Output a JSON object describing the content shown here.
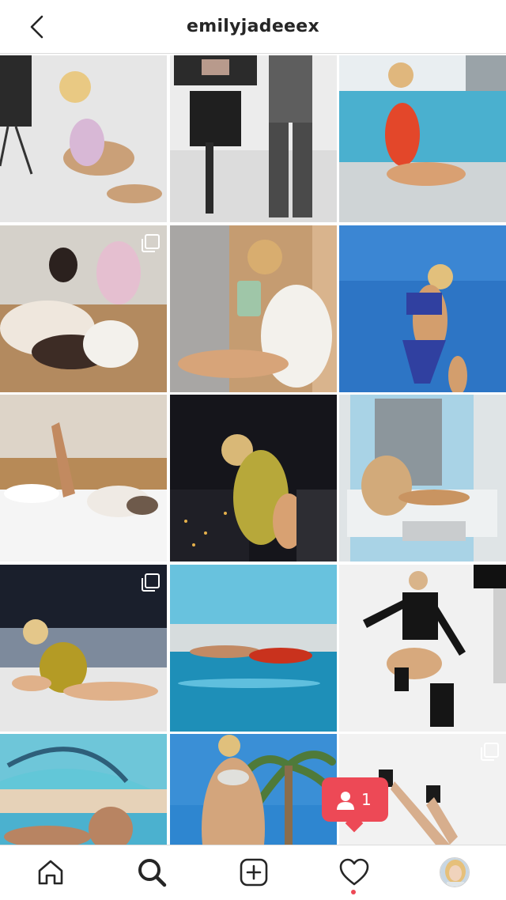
{
  "header": {
    "title": "emilyjadeeex",
    "back_icon": "chevron-left-icon"
  },
  "grid": {
    "posts": [
      {
        "id": 1,
        "multi": false,
        "palette": [
          "#e9e9e9",
          "#c9a07b",
          "#d8b8d6"
        ]
      },
      {
        "id": 2,
        "multi": false,
        "palette": [
          "#eeeeee",
          "#2a2a2a",
          "#6b6b6b"
        ]
      },
      {
        "id": 3,
        "multi": false,
        "palette": [
          "#8fc6d9",
          "#e3472a",
          "#d9a072"
        ]
      },
      {
        "id": 4,
        "multi": true,
        "palette": [
          "#d7d3cd",
          "#3b2f2b",
          "#e7c6d2"
        ]
      },
      {
        "id": 5,
        "multi": false,
        "palette": [
          "#c9a277",
          "#f2f0ec",
          "#d7a479"
        ]
      },
      {
        "id": 6,
        "multi": false,
        "palette": [
          "#2f79c7",
          "#3040a0",
          "#d39e6d"
        ]
      },
      {
        "id": 7,
        "multi": false,
        "palette": [
          "#ddd3c6",
          "#f5f5f5",
          "#c28a60"
        ]
      },
      {
        "id": 8,
        "multi": false,
        "palette": [
          "#16161c",
          "#b7a83a",
          "#d8a172"
        ]
      },
      {
        "id": 9,
        "multi": false,
        "palette": [
          "#a9d3e6",
          "#eef1f2",
          "#c99461"
        ]
      },
      {
        "id": 10,
        "multi": true,
        "palette": [
          "#1a1f2c",
          "#b49b25",
          "#e0b18a"
        ]
      },
      {
        "id": 11,
        "multi": false,
        "palette": [
          "#4ab3d8",
          "#1f8fb8",
          "#c9321d"
        ]
      },
      {
        "id": 12,
        "multi": false,
        "palette": [
          "#f0f0f0",
          "#141414",
          "#d7a97d"
        ]
      },
      {
        "id": 13,
        "multi": false,
        "palette": [
          "#4bb1cf",
          "#62c7d8",
          "#b88462"
        ]
      },
      {
        "id": 14,
        "multi": false,
        "palette": [
          "#2e86d0",
          "#4f7a3a",
          "#d3a57c"
        ]
      },
      {
        "id": 15,
        "multi": true,
        "palette": [
          "#f2f2f2",
          "#1a1a1a",
          "#d7ae8d"
        ]
      }
    ]
  },
  "notification": {
    "icon": "person-icon",
    "count": "1",
    "color": "#ed4956"
  },
  "tabbar": {
    "items": [
      {
        "name": "home",
        "icon": "home-icon"
      },
      {
        "name": "search",
        "icon": "search-icon",
        "active": true
      },
      {
        "name": "new-post",
        "icon": "plus-square-icon"
      },
      {
        "name": "activity",
        "icon": "heart-icon"
      },
      {
        "name": "profile",
        "icon": "avatar"
      }
    ]
  }
}
